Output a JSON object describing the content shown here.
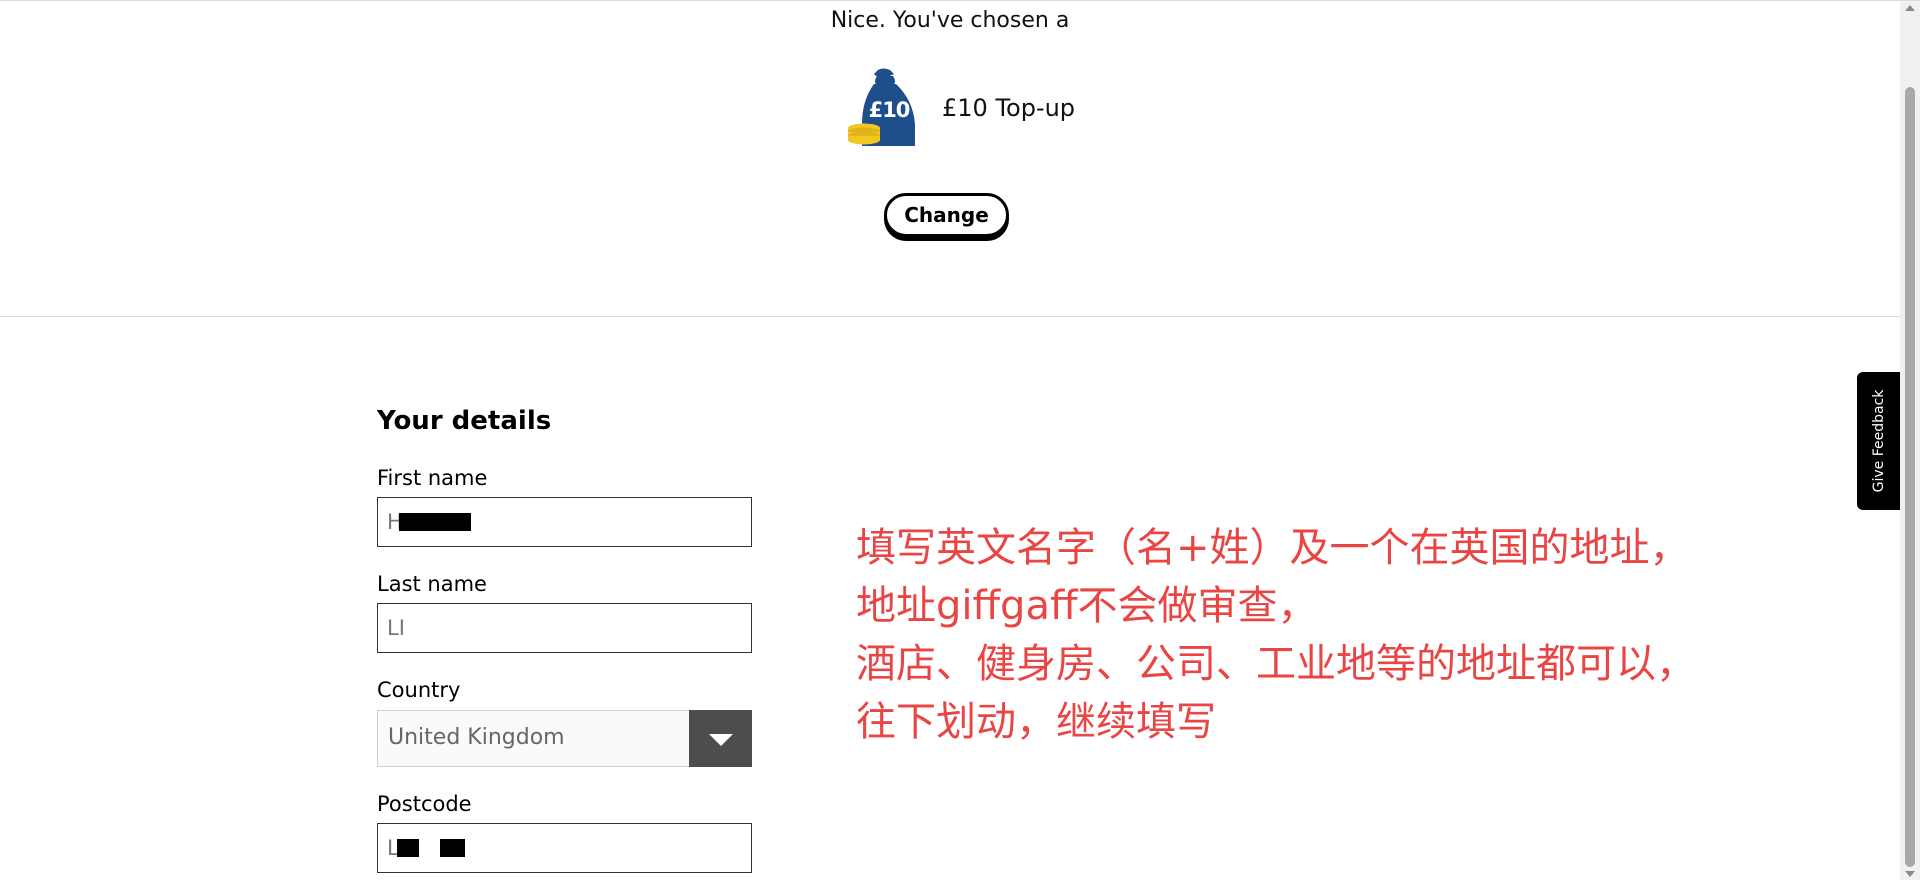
{
  "selection": {
    "chosen_text": "Nice. You've chosen a",
    "bag_label": "£10",
    "product_name": "£10 Top-up",
    "change_label": "Change"
  },
  "details": {
    "title": "Your details",
    "first_name": {
      "label": "First name",
      "value": "H"
    },
    "last_name": {
      "label": "Last name",
      "value": "LI"
    },
    "country": {
      "label": "Country",
      "value": "United Kingdom"
    },
    "postcode": {
      "label": "Postcode",
      "value": "L 4"
    }
  },
  "annotation": {
    "lines": [
      "填写英文名字（名+姓）及一个在英国的地址，",
      "地址giffgaff不会做审查，",
      "酒店、健身房、公司、工业地等的地址都可以，",
      "往下划动，继续填写"
    ]
  },
  "feedback": {
    "label": "Give Feedback"
  },
  "colors": {
    "bag_blue": "#1f4e8c",
    "coin_yellow": "#f2c623",
    "annotation_red": "#e94545"
  }
}
